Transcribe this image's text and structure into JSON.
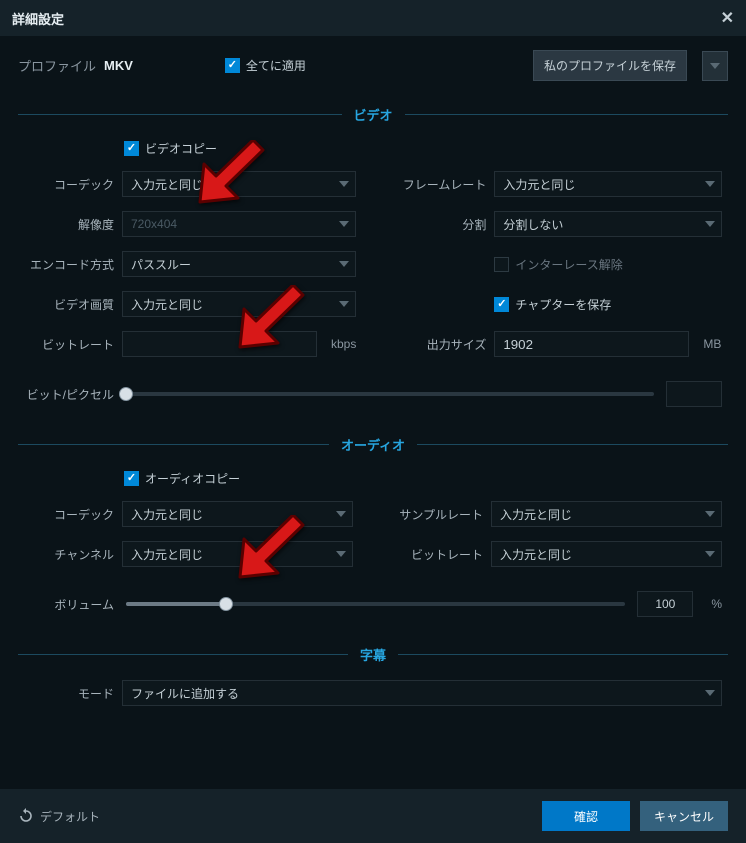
{
  "title": "詳細設定",
  "profile": {
    "label": "プロファイル",
    "name": "MKV"
  },
  "apply_all": {
    "label": "全てに適用",
    "checked": true
  },
  "save_profile_btn": "私のプロファイルを保存",
  "sections": {
    "video": {
      "title": "ビデオ",
      "copy": {
        "label": "ビデオコピー",
        "checked": true
      },
      "codec": {
        "label": "コーデック",
        "value": "入力元と同じ"
      },
      "resolution": {
        "label": "解像度",
        "value": "720x404",
        "disabled": true
      },
      "encode_mode": {
        "label": "エンコード方式",
        "value": "パススルー"
      },
      "quality": {
        "label": "ビデオ画質",
        "value": "入力元と同じ"
      },
      "bitrate": {
        "label": "ビットレート",
        "value": "",
        "unit": "kbps"
      },
      "framerate": {
        "label": "フレームレート",
        "value": "入力元と同じ"
      },
      "split": {
        "label": "分割",
        "value": "分割しない"
      },
      "deinterlace": {
        "label": "インターレース解除",
        "checked": false
      },
      "keep_chapters": {
        "label": "チャプターを保存",
        "checked": true
      },
      "output_size": {
        "label": "出力サイズ",
        "value": "1902",
        "unit": "MB"
      },
      "bitpixel": {
        "label": "ビット/ピクセル",
        "value": "",
        "percent": 0
      }
    },
    "audio": {
      "title": "オーディオ",
      "copy": {
        "label": "オーディオコピー",
        "checked": true
      },
      "codec": {
        "label": "コーデック",
        "value": "入力元と同じ"
      },
      "channel": {
        "label": "チャンネル",
        "value": "入力元と同じ"
      },
      "samplerate": {
        "label": "サンプルレート",
        "value": "入力元と同じ"
      },
      "bitrate": {
        "label": "ビットレート",
        "value": "入力元と同じ"
      },
      "volume": {
        "label": "ボリューム",
        "value": "100",
        "unit": "%",
        "percent": 20
      }
    },
    "subtitle": {
      "title": "字幕",
      "mode": {
        "label": "モード",
        "value": "ファイルに追加する"
      }
    }
  },
  "footer": {
    "default": "デフォルト",
    "ok": "確認",
    "cancel": "キャンセル"
  }
}
